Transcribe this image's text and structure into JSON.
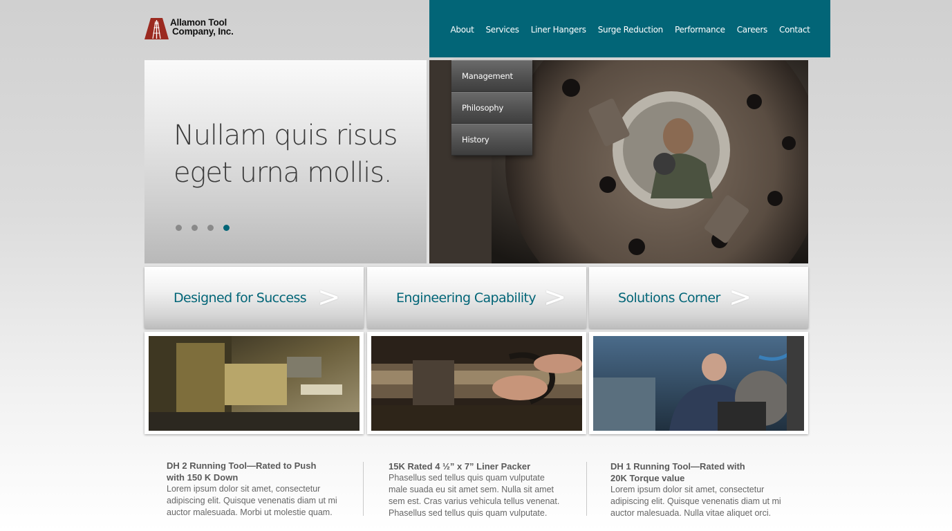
{
  "brand": {
    "name_line1": "Allamon Tool",
    "name_line2": "Company, Inc.",
    "logo_color": "#9b2a20"
  },
  "nav": {
    "bg_color": "#026577",
    "items": [
      {
        "label": "About"
      },
      {
        "label": "Services"
      },
      {
        "label": "Liner Hangers"
      },
      {
        "label": "Surge Reduction"
      },
      {
        "label": "Performance"
      },
      {
        "label": "Careers"
      },
      {
        "label": "Contact"
      }
    ]
  },
  "about_dropdown": {
    "items": [
      {
        "label": "Management"
      },
      {
        "label": "Philosophy"
      },
      {
        "label": "History"
      }
    ]
  },
  "hero": {
    "headline_line1": "Nullam quis risus",
    "headline_line2": "eget urna mollis.",
    "slides_count": 4,
    "active_slide": 4,
    "image_icon": "machinist-through-lathe-chuck-photo"
  },
  "features": [
    {
      "title": "Designed for Success",
      "chevron": ">",
      "image_icon": "lathe-closeup-photo"
    },
    {
      "title": "Engineering Capability",
      "chevron": ">",
      "image_icon": "hands-measuring-pipe-photo"
    },
    {
      "title": "Solutions Corner",
      "chevron": ">",
      "image_icon": "worker-operating-machine-photo"
    }
  ],
  "articles": [
    {
      "title_line1": "DH 2 Running Tool—Rated to Push",
      "title_line2": "with 150 K Down",
      "body": "Lorem ipsum dolor sit amet, consectetur adipiscing elit. Quisque venenatis diam ut mi auctor malesuada. Morbi ut molestie quam."
    },
    {
      "title_line1": "15K Rated 4 ½” x 7” Liner Packer",
      "title_line2": "",
      "body": "Phasellus sed tellus quis quam vulputate male suada eu sit amet sem. Nulla sit amet sem est. Cras varius vehicula tellus venenat. Phasellus sed tellus quis quam vulputate."
    },
    {
      "title_line1": "DH 1  Running Tool—Rated with",
      "title_line2": "20K Torque value",
      "body": "Lorem ipsum dolor sit amet, consectetur adipiscing elit. Quisque venenatis diam ut mi auctor malesuada. Nulla vitae aliquet orci."
    }
  ]
}
